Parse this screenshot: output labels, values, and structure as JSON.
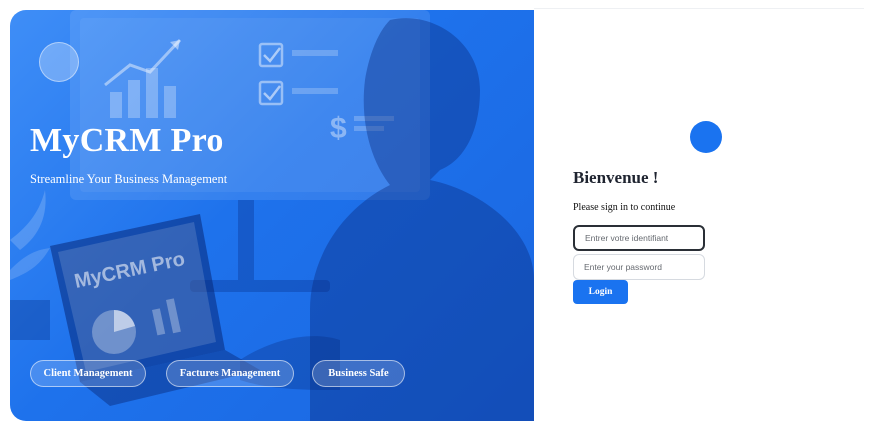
{
  "hero": {
    "title": "MyCRM Pro",
    "subtitle": "Streamline Your Business Management",
    "laptop_screen_text": "MyCRM Pro",
    "features": [
      {
        "label": "Client Management"
      },
      {
        "label": "Factures Management"
      },
      {
        "label": "Business Safe"
      }
    ]
  },
  "login": {
    "title": "Bienvenue !",
    "subtitle": "Please sign in to continue",
    "username": {
      "value": "",
      "placeholder": "Entrer votre identifiant"
    },
    "password": {
      "value": "",
      "placeholder": "Enter your password"
    },
    "submit_label": "Login"
  },
  "colors": {
    "brand_blue": "#1a73f0",
    "hero_blue": "#1e72ec",
    "text_dark": "#1f2430",
    "white": "#ffffff"
  },
  "icons": [
    "logo-circle-icon",
    "bar-chart-icon",
    "checkbox-icon",
    "dollar-icon",
    "pie-chart-icon",
    "plant-icon"
  ]
}
